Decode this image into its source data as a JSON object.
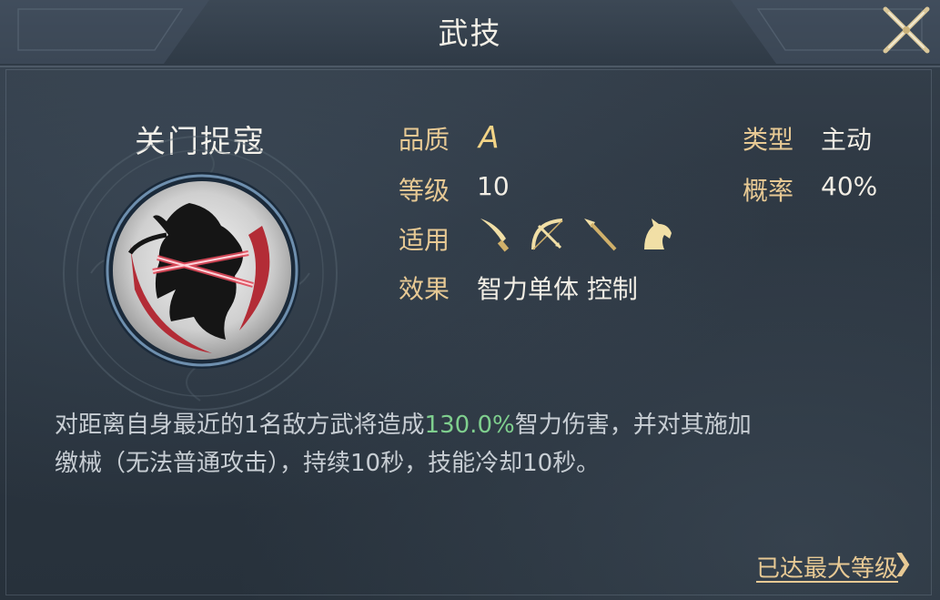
{
  "header": {
    "title": "武技"
  },
  "skill": {
    "name": "关门捉寇",
    "quality_label": "品质",
    "quality_value": "A",
    "level_label": "等级",
    "level_value": "10",
    "applicable_label": "适用",
    "applicable_icons": [
      "saber-icon",
      "bow-icon",
      "spear-icon",
      "horse-icon"
    ],
    "effect_label": "效果",
    "effect_value": "智力单体 控制",
    "type_label": "类型",
    "type_value": "主动",
    "rate_label": "概率",
    "rate_value": "40%"
  },
  "description": {
    "part1": "对距离自身最近的1名敌方武将造成",
    "highlight": "130.0%",
    "part2": "智力伤害，并对其施加",
    "line2": "缴械（无法普通攻击），持续10秒，技能冷却10秒。"
  },
  "footer": {
    "max_level": "已达最大等级",
    "chevron": "❯"
  },
  "colors": {
    "label_gold": "#e7c994",
    "highlight_green": "#7fcf8e",
    "background": "#2c3641"
  }
}
